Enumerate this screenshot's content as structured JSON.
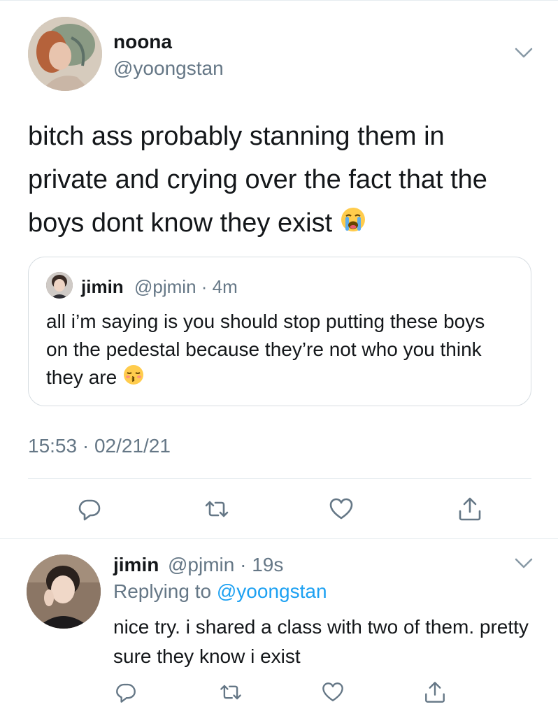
{
  "tweet": {
    "author_name": "noona",
    "author_handle": "@yoongstan",
    "text": "bitch ass probably stanning them in private and crying over the fact that the boys dont know they exist",
    "emoji": "loudly-crying-face",
    "timestamp": "15:53 · 02/21/21",
    "quote": {
      "author_name": "jimin",
      "author_handle_meta": "@pjmin · 4m",
      "text": "all i’m saying is you should stop putting these boys on the pedestal because they’re not who you think they are",
      "emoji": "kissing-face-with-closed-eyes"
    },
    "actions": [
      "reply-icon",
      "retweet-icon",
      "like-icon",
      "share-icon"
    ]
  },
  "reply": {
    "author_name": "jimin",
    "author_handle_meta": "@pjmin · 19s",
    "replying_prefix": "Replying to",
    "replying_to": "@yoongstan",
    "text": "nice try. i shared a class with two of them. pretty sure they know i exist",
    "actions": [
      "reply-icon",
      "retweet-icon",
      "like-icon",
      "share-icon"
    ]
  },
  "colors": {
    "text": "#14171a",
    "secondary": "#657786",
    "link": "#1da1f2",
    "border": "#e6ecf0"
  }
}
